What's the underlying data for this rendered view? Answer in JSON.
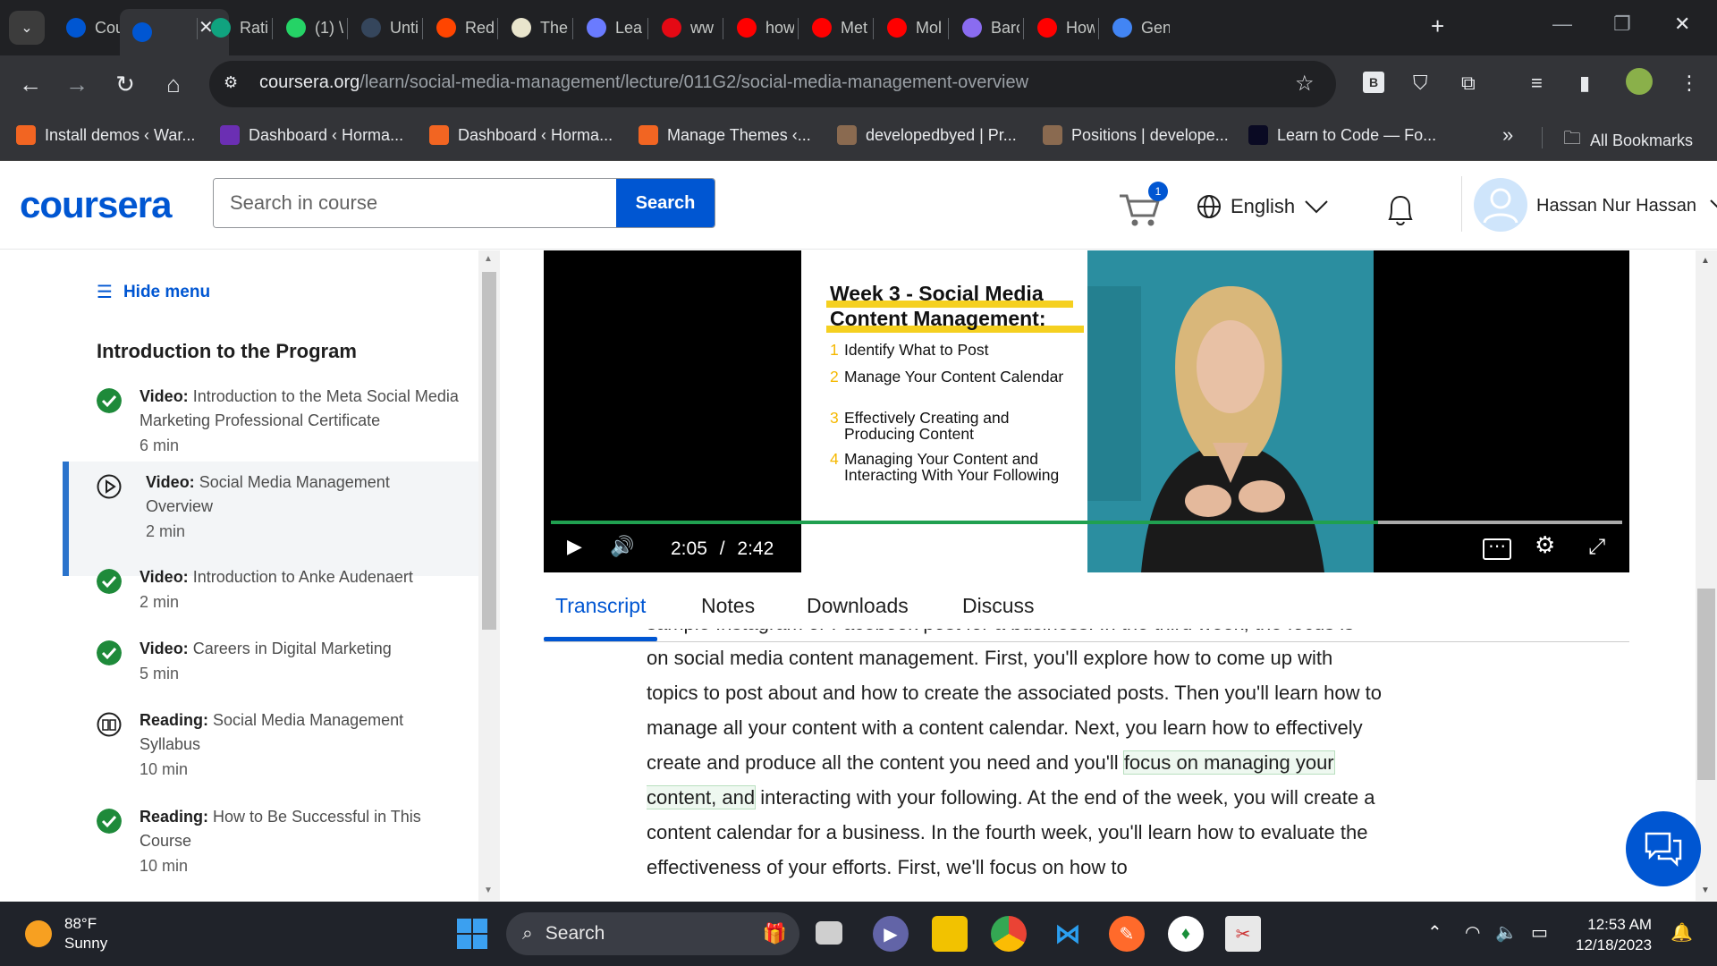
{
  "browser": {
    "tabs": [
      {
        "label": "Cou",
        "icon": "coursera-icon",
        "color": "#0056d2"
      },
      {
        "label": "",
        "icon": "coursera-icon",
        "color": "#0056d2",
        "active": true
      },
      {
        "label": "Rati",
        "icon": "chatgpt-icon",
        "color": "#10a37f"
      },
      {
        "label": "(1) \\",
        "icon": "whatsapp-icon",
        "color": "#25d366"
      },
      {
        "label": "Unti",
        "icon": "tumblr-icon",
        "color": "#35465c"
      },
      {
        "label": "Red",
        "icon": "reddit-icon",
        "color": "#ff4500"
      },
      {
        "label": "The",
        "icon": "goodreads-icon",
        "color": "#e9e5cd"
      },
      {
        "label": "Lea",
        "icon": "colorful-circle-icon",
        "color": "#6a7bff"
      },
      {
        "label": "ww",
        "icon": "netflix-icon",
        "color": "#e50914"
      },
      {
        "label": "how",
        "icon": "youtube-icon",
        "color": "#ff0000"
      },
      {
        "label": "Met",
        "icon": "youtube-icon",
        "color": "#ff0000"
      },
      {
        "label": "Mol",
        "icon": "youtube-icon",
        "color": "#ff0000"
      },
      {
        "label": "Barc",
        "icon": "bard-icon",
        "color": "#8a6cf0"
      },
      {
        "label": "How",
        "icon": "youtube-icon",
        "color": "#ff0000"
      },
      {
        "label": "Gen",
        "icon": "circle-icon",
        "color": "#4285f4"
      }
    ],
    "url_domain": "coursera.org",
    "url_path": "/learn/social-media-management/lecture/011G2/social-media-management-overview",
    "bookmarks": [
      {
        "label": "Install demos ‹ War...",
        "color": "#f26522"
      },
      {
        "label": "Dashboard ‹ Horma...",
        "color": "#6b2fb3"
      },
      {
        "label": "Dashboard ‹ Horma...",
        "color": "#f26522"
      },
      {
        "label": "Manage Themes ‹...",
        "color": "#f26522"
      },
      {
        "label": "developedbyed | Pr...",
        "color": "#8a6a50"
      },
      {
        "label": "Positions | develope...",
        "color": "#8a6a50"
      },
      {
        "label": "Learn to Code — Fo...",
        "color": "#0a0a23"
      }
    ],
    "more_bookmarks": "»",
    "all_bookmarks": "All Bookmarks"
  },
  "header": {
    "logo": "coursera",
    "search_placeholder": "Search in course",
    "search_button": "Search",
    "cart_count": "1",
    "language": "English",
    "user_name": "Hassan Nur Hassan"
  },
  "sidebar": {
    "hide_menu": "Hide menu",
    "module_title": "Introduction to the Program",
    "items": [
      {
        "type": "Video:",
        "title": "Introduction to the Meta Social Media Marketing Professional Certificate",
        "time": "6 min",
        "status": "completed"
      },
      {
        "type": "Video:",
        "title": "Social Media Management Overview",
        "time": "2 min",
        "status": "current"
      },
      {
        "type": "Video:",
        "title": "Introduction to Anke Audenaert",
        "time": "2 min",
        "status": "completed"
      },
      {
        "type": "Video:",
        "title": "Careers in Digital Marketing",
        "time": "5 min",
        "status": "completed"
      },
      {
        "type": "Reading:",
        "title": "Social Media Management Syllabus",
        "time": "10 min",
        "status": "reading"
      },
      {
        "type": "Reading:",
        "title": "How to Be Successful in This Course",
        "time": "10 min",
        "status": "completed"
      }
    ]
  },
  "video": {
    "slide_title_line1": "Week 3 - Social Media",
    "slide_title_line2": "Content Management:",
    "slide_items": [
      {
        "num": "1",
        "text": "Identify What to Post"
      },
      {
        "num": "2",
        "text": "Manage Your Content Calendar"
      },
      {
        "num": "3",
        "text": "Effectively Creating and Producing Content"
      },
      {
        "num": "4",
        "text": "Managing Your Content and Interacting With Your Following"
      }
    ],
    "current_time": "2:05",
    "separator": "/",
    "duration": "2:42",
    "progress_fraction": 0.772
  },
  "content_tabs": [
    "Transcript",
    "Notes",
    "Downloads",
    "Discuss"
  ],
  "transcript": {
    "cut_line": "sample Instagram or Facebook post for a business. In the third week, the focus is",
    "before_highlight": "on social media content management. First, you'll explore how to come up with topics to post about and how to create the associated posts. Then you'll learn how to manage all your content with a content calendar. Next, you learn how to effectively create and produce all the content you need and you'll ",
    "highlight": "focus on managing your content, and",
    "after_highlight": " interacting with your following. At the end of the week, you will create a content calendar for a business. In the fourth week, you'll learn how to evaluate the effectiveness of your efforts. First, we'll focus on how to"
  },
  "taskbar": {
    "temperature": "88°F",
    "condition": "Sunny",
    "search_label": "Search",
    "time": "12:53 AM",
    "date": "12/18/2023"
  },
  "colors": {
    "accent": "#0056d2",
    "success": "#1e8a3a",
    "progress": "#20a050"
  }
}
